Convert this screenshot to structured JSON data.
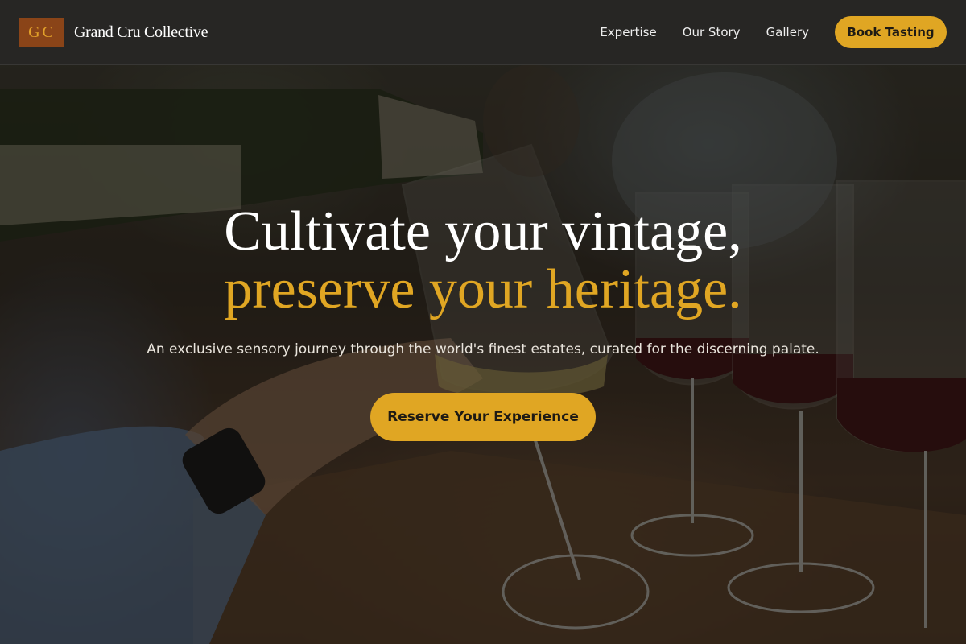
{
  "nav": {
    "logo_mark": "GC",
    "brand_name": "Grand Cru Collective",
    "links": [
      {
        "label": "Expertise"
      },
      {
        "label": "Our Story"
      },
      {
        "label": "Gallery"
      }
    ],
    "cta_label": "Book Tasting"
  },
  "hero": {
    "headline_line1": "Cultivate your vintage,",
    "headline_line2": "preserve your heritage.",
    "subtitle": "An exclusive sensory journey through the world's finest estates, curated for the discerning palate.",
    "cta_label": "Reserve Your Experience"
  },
  "colors": {
    "accent": "#e0a623",
    "logo_bg": "#8a4418",
    "navbar_bg": "#282624"
  }
}
